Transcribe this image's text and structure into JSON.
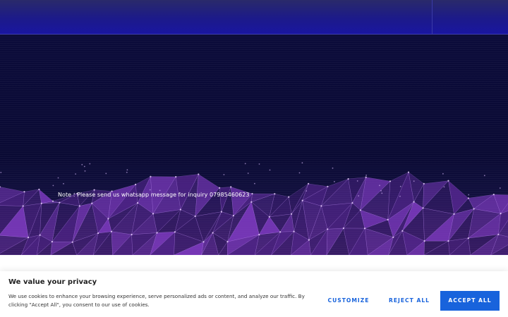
{
  "hero": {
    "note": "Note : Please send us whatsapp message for inquiry 07985460623"
  },
  "cookie_banner": {
    "title": "We value your privacy",
    "text": "We use cookies to enhance your browsing experience, serve personalized ads or content, and analyze our traffic. By clicking \"Accept All\", you consent to our use of cookies.",
    "customize_label": "CUSTOMIZE",
    "reject_label": "REJECT ALL",
    "accept_label": "ACCEPT ALL"
  },
  "colors": {
    "accent": "#1863dc",
    "nav": "#1a16a0",
    "hero_bg": "#0a0a34",
    "network": "#8a3fd0"
  }
}
